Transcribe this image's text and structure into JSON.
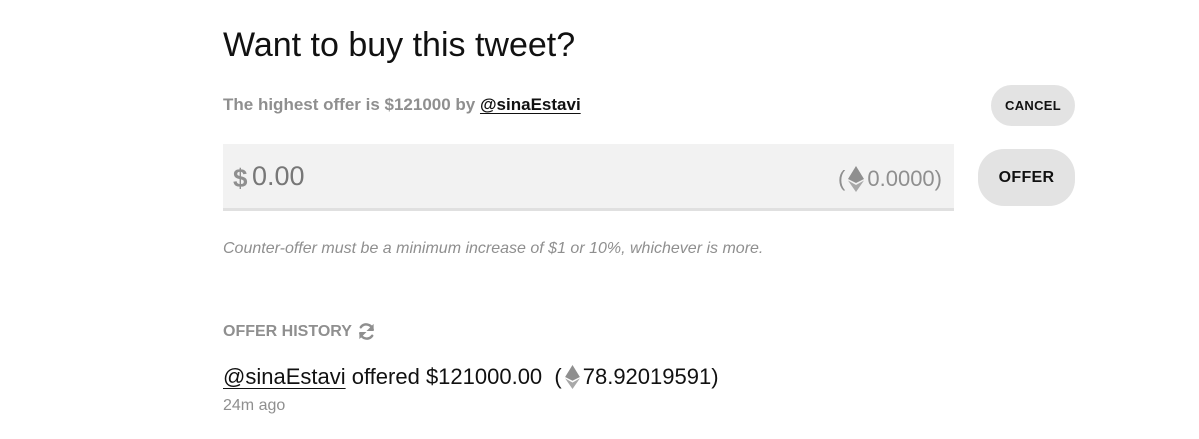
{
  "offer_panel": {
    "title": "Want to buy this tweet?",
    "highest_prefix": "The highest offer is $121000 by ",
    "highest_user": "@sinaEstavi",
    "cancel_label": "CANCEL",
    "currency_symbol": "$",
    "amount_placeholder": "0.00",
    "eth_open": "(",
    "eth_value": "0.0000",
    "eth_close": ")",
    "offer_label": "OFFER",
    "rule_text": "Counter-offer must be a minimum increase of $1 or 10%, whichever is more."
  },
  "history": {
    "header": "OFFER HISTORY",
    "entries": [
      {
        "user": "@sinaEstavi",
        "action": "offered $121000.00",
        "eth_open": "(",
        "eth_value": "78.92019591",
        "eth_close": ")",
        "time": "24m ago"
      }
    ]
  },
  "icons": {
    "eth": "ethereum-icon",
    "refresh": "refresh-icon"
  },
  "colors": {
    "muted_text": "#8f8f8f",
    "button_bg": "#e3e3e3",
    "input_bg": "#f2f2f2"
  }
}
